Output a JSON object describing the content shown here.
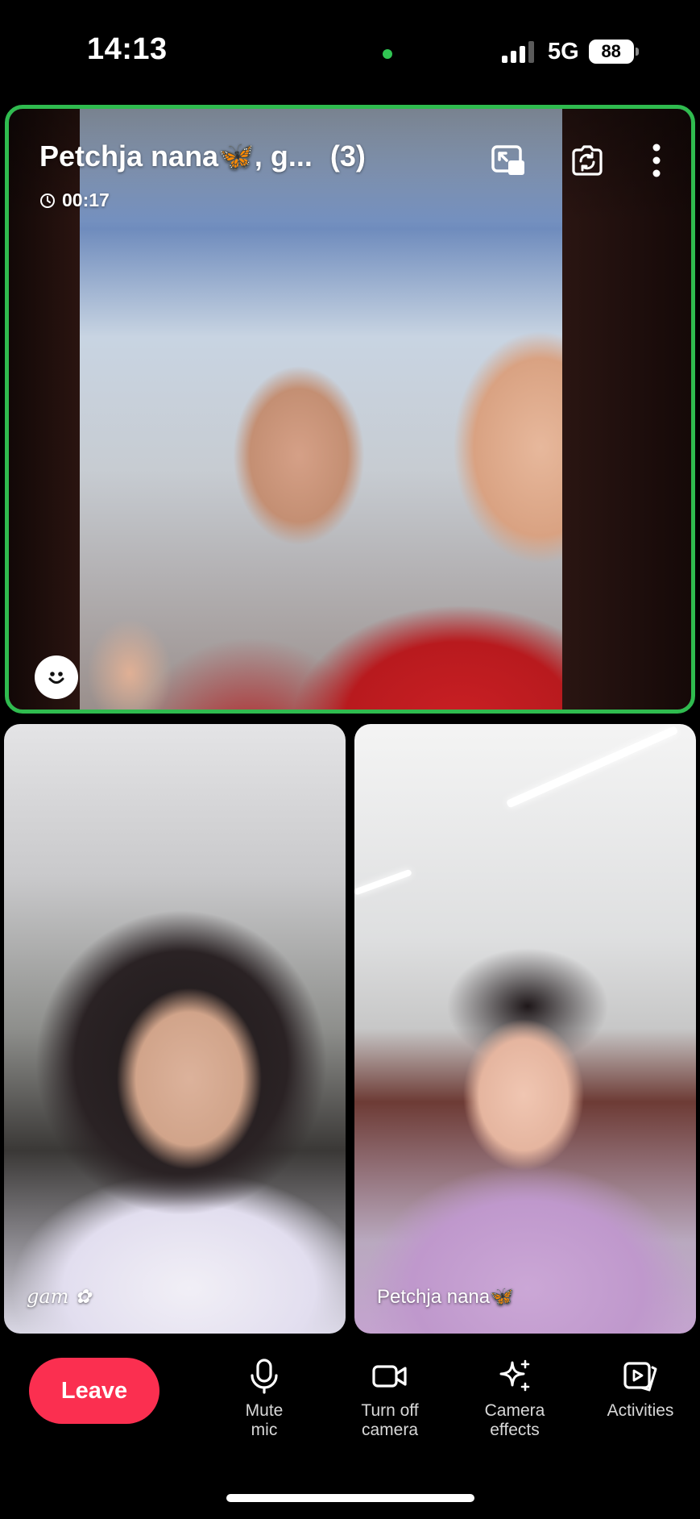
{
  "status_bar": {
    "time": "14:13",
    "network": "5G",
    "battery": "88",
    "signal_bars": 4,
    "signal_bars_active": 3,
    "mic_indicator_color": "#31c553"
  },
  "call": {
    "title": "Petchja nana🦋, g...",
    "participant_count": "(3)",
    "duration": "00:17",
    "active_speaker_border": "#2fbb4f"
  },
  "tiles": [
    {
      "name": "gam ✿"
    },
    {
      "name": "Petchja nana🦋"
    }
  ],
  "controls": {
    "leave": "Leave",
    "leave_color": "#fb2f50",
    "mute_line1": "Mute",
    "mute_line2": "mic",
    "camera_line1": "Turn off",
    "camera_line2": "camera",
    "effects_line1": "Camera",
    "effects_line2": "effects",
    "activities": "Activities"
  },
  "icons": {
    "pip": "picture-in-picture-icon",
    "flip": "flip-camera-icon",
    "more": "more-vertical-icon",
    "reaction": "smiley-icon",
    "mic": "microphone-icon",
    "camera": "video-camera-icon",
    "effects": "sparkles-icon",
    "activities": "activities-icon"
  }
}
